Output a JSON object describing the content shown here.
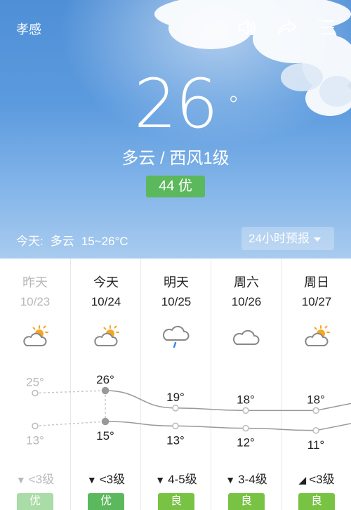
{
  "header": {
    "city": "孝感",
    "temperature": "26",
    "degree_symbol": "°",
    "condition": "多云 / 西风1级",
    "aqi": "44 优",
    "today_summary_label": "今天:",
    "today_summary_condition": "多云",
    "today_summary_range": "15~26°C",
    "forecast_button": "24小时预报",
    "icons": [
      "speaker-icon",
      "share-icon",
      "menu-icon"
    ]
  },
  "days": [
    {
      "name": "昨天",
      "date": "10/23",
      "icon": "partly-sunny-icon",
      "high": "25°",
      "low": "13°",
      "wind": "<3级",
      "aq": "优",
      "aq_color": "#a9dca6",
      "past": true
    },
    {
      "name": "今天",
      "date": "10/24",
      "icon": "partly-sunny-icon",
      "high": "26°",
      "low": "15°",
      "wind": "<3级",
      "aq": "优",
      "aq_color": "#5cb85c",
      "past": false
    },
    {
      "name": "明天",
      "date": "10/25",
      "icon": "light-rain-icon",
      "high": "19°",
      "low": "13°",
      "wind": "4-5级",
      "aq": "良",
      "aq_color": "#78c244",
      "past": false
    },
    {
      "name": "周六",
      "date": "10/26",
      "icon": "cloudy-icon",
      "high": "18°",
      "low": "12°",
      "wind": "3-4级",
      "aq": "良",
      "aq_color": "#78c244",
      "past": false
    },
    {
      "name": "周日",
      "date": "10/27",
      "icon": "partly-sunny-icon",
      "high": "18°",
      "low": "11°",
      "wind": "<3级",
      "aq": "良",
      "aq_color": "#78c244",
      "past": false
    }
  ],
  "chart_data": {
    "type": "line",
    "categories": [
      "10/23",
      "10/24",
      "10/25",
      "10/26",
      "10/27"
    ],
    "series": [
      {
        "values": [
          25,
          26,
          19,
          18,
          18
        ]
      },
      {
        "values": [
          13,
          15,
          13,
          12,
          11
        ]
      }
    ]
  },
  "colors": {
    "sky_top": "#4f8fd6",
    "aqi_good": "#5cb85c",
    "aqi_moderate": "#78c244",
    "line": "#999999"
  }
}
